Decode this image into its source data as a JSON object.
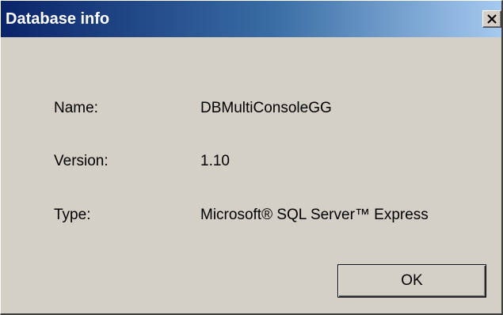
{
  "window": {
    "title": "Database info",
    "close_icon": "close-icon"
  },
  "info": {
    "name_label": "Name:",
    "name_value": "DBMultiConsoleGG",
    "version_label": "Version:",
    "version_value": "1.10",
    "type_label": "Type:",
    "type_value": "Microsoft® SQL Server™ Express"
  },
  "buttons": {
    "ok_label": "OK"
  },
  "colors": {
    "titlebar_start": "#0a246a",
    "titlebar_end": "#a6caf0",
    "dialog_bg": "#d4d0c8"
  }
}
